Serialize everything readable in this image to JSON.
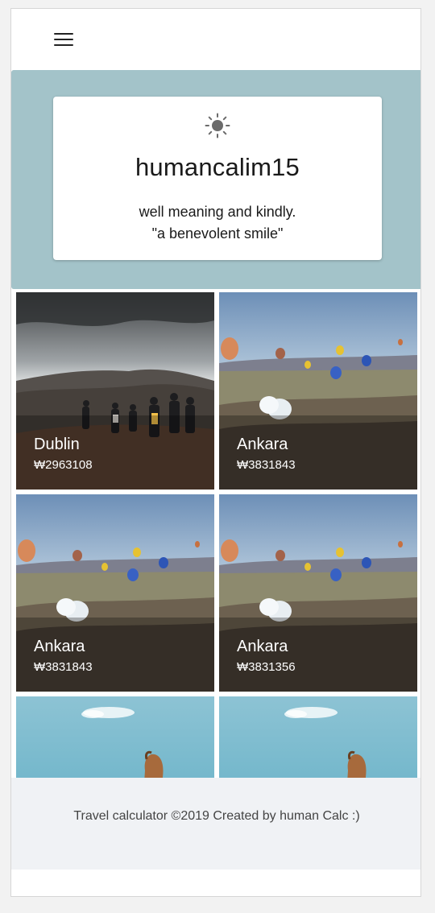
{
  "header": {
    "menu_icon": "hamburger-menu-icon"
  },
  "profile": {
    "icon": "sun-icon",
    "username": "humancalim15",
    "bio_line1": "well meaning and kindly.",
    "bio_line2": "\"a benevolent smile\"",
    "background_color": "#a3c3c9"
  },
  "destinations": [
    {
      "city": "Dublin",
      "price": "₩2963108",
      "scene": "mountain-hikers"
    },
    {
      "city": "Ankara",
      "price": "₩3831843",
      "scene": "hot-air-balloons"
    },
    {
      "city": "Ankara",
      "price": "₩3831843",
      "scene": "hot-air-balloons"
    },
    {
      "city": "Ankara",
      "price": "₩3831356",
      "scene": "hot-air-balloons"
    },
    {
      "city": "",
      "price": "",
      "scene": "camel-sky"
    },
    {
      "city": "",
      "price": "",
      "scene": "camel-sky"
    }
  ],
  "footer": {
    "text": "Travel calculator ©2019 Created by human Calc :)"
  }
}
